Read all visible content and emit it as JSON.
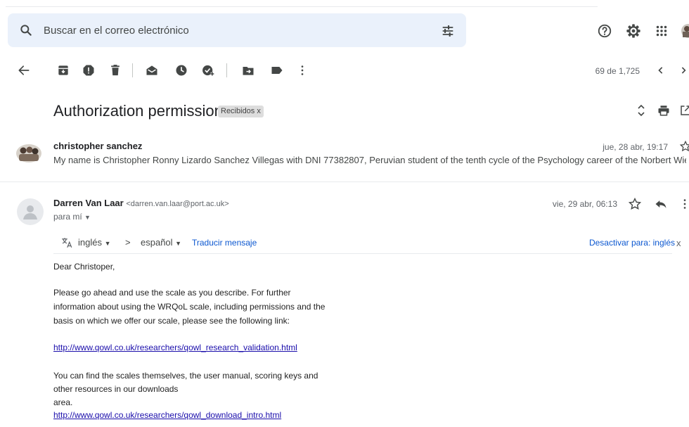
{
  "search": {
    "placeholder": "Buscar en el correo electrónico"
  },
  "toolbar": {
    "counter": "69 de 1,725"
  },
  "thread": {
    "subject": "Authorization permission",
    "label": "Recibidos",
    "label_close": "x"
  },
  "message1": {
    "sender": "christopher sanchez",
    "date": "jue, 28 abr, 19:17",
    "snippet": "My name is Christopher Ronny Lizardo Sanchez Villegas with DNI 77382807, Peruvian student of the tenth cycle of the Psychology career of the Norbert Wiener Priv"
  },
  "message2": {
    "sender": "Darren Van Laar",
    "address": "<darren.van.laar@port.ac.uk>",
    "to": "para mí",
    "date": "vie, 29 abr, 06:13"
  },
  "translate": {
    "from": "inglés",
    "arrow": ">",
    "to": "español",
    "action": "Traducir mensaje",
    "disable": "Desactivar para: inglés",
    "close": "x"
  },
  "body": {
    "greeting": "Dear Christoper,",
    "p1_line1": "Please go ahead and use the scale as you describe. For further",
    "p1_line2": "information about using the WRQoL scale, including permissions and the",
    "p1_line3": "basis on which we offer our scale, please see the following link:",
    "link1": "http://www.qowl.co.uk/researchers/qowl_research_validation.html",
    "p2_line1": "You can find the scales themselves, the user manual, scoring keys and",
    "p2_line2": "other resources in our downloads",
    "p2_line3": "area.",
    "link2": "http://www.qowl.co.uk/researchers/qowl_download_intro.html"
  },
  "icons": [
    "search-icon",
    "filter-icon",
    "help-icon",
    "settings-icon",
    "apps-icon",
    "account-avatar",
    "back-arrow-icon",
    "archive-icon",
    "report-spam-icon",
    "delete-icon",
    "mark-unread-icon",
    "snooze-icon",
    "add-task-icon",
    "move-to-icon",
    "label-icon",
    "more-vert-icon",
    "prev-icon",
    "next-icon",
    "expand-icon",
    "print-icon",
    "open-new-window-icon",
    "star-icon",
    "reply-icon",
    "translate-icon"
  ],
  "colors": {
    "search_bg": "#eaf1fb",
    "link": "#1a0dab",
    "translate_link": "#0b57d0",
    "icon": "#444746"
  }
}
